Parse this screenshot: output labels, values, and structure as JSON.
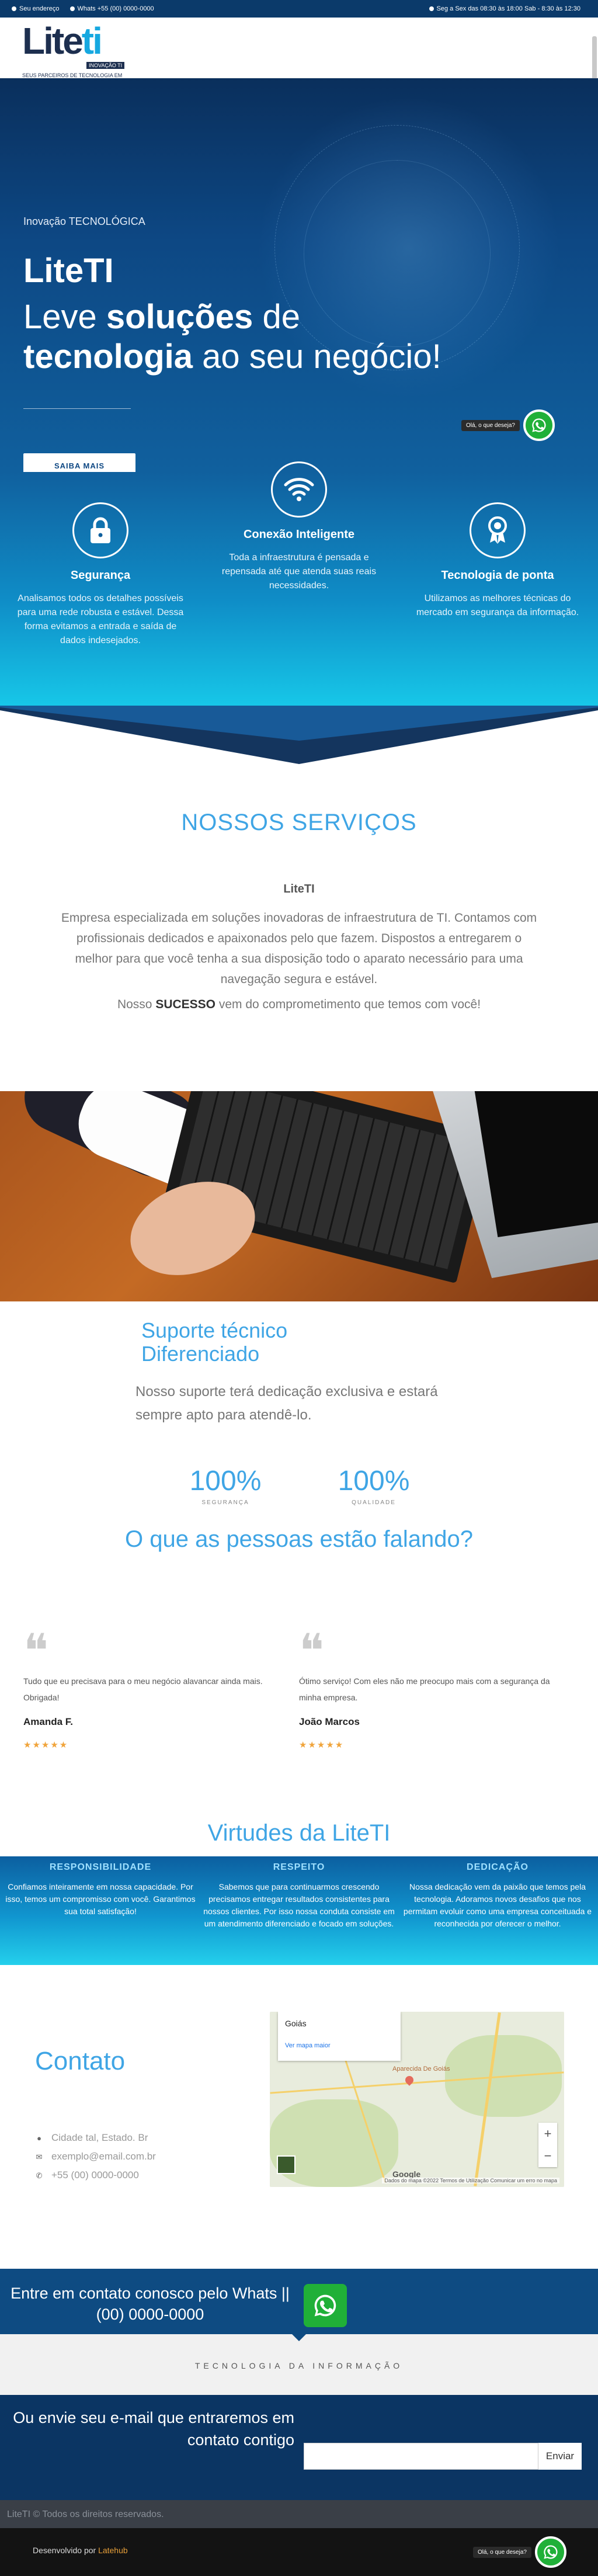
{
  "topbar": {
    "email": "Seu endereço",
    "whats": "Whats +55 (00) 0000-0000",
    "hours": "Seg a Sex das 08:30 às 18:00 Sab - 8:30 às 12:30"
  },
  "logo": {
    "brand_a": "Lite",
    "brand_b": "ti",
    "badge": "INOVAÇÃO TI",
    "tagline": "SEUS PARCEIROS DE TECNOLOGIA EM SEU NEGÓCIO"
  },
  "hero": {
    "kicker": "Inovação TECNOLÓGICA",
    "brand": "LiteTI",
    "line1_a": "Leve ",
    "line1_b": "soluções",
    "line1_c": " de",
    "line2_a": "tecnologia",
    "line2_b": " ao seu negócio!",
    "button": "SAIBA MAIS"
  },
  "whatsapp_chip": "Olá, o que deseja?",
  "features": [
    {
      "icon": "lock-icon",
      "title": "Segurança",
      "text": "Analisamos todos os detalhes possíveis para uma rede robusta e estável. Dessa forma evitamos a entrada e saída de dados indesejados."
    },
    {
      "icon": "wifi-icon",
      "title": "Conexão Inteligente",
      "text": "Toda a infraestrutura é pensada e repensada até que atenda suas reais necessidades."
    },
    {
      "icon": "award-icon",
      "title": "Tecnologia de ponta",
      "text": "Utilizamos as melhores técnicas do mercado em segurança da informação."
    }
  ],
  "services": {
    "title": "NOSSOS SERVIÇOS",
    "subtitle": "LiteTI",
    "paragraph": "Empresa especializada em soluções inovadoras de infraestrutura de TI. Contamos com profissionais dedicados e apaixonados pelo que fazem. Dispostos a entregarem o melhor para que você tenha  a sua disposição todo o aparato necessário para uma navegação segura e estável.",
    "last_a": "Nosso ",
    "last_b": "SUCESSO",
    "last_c": " vem do comprometimento que temos com você!"
  },
  "support": {
    "title_1": "Suporte técnico",
    "title_2": "Diferenciado",
    "text": "Nosso suporte terá dedicação exclusiva e estará sempre apto para atendê-lo.",
    "stats": [
      {
        "value": "100%",
        "label": "SEGURANÇA"
      },
      {
        "value": "100%",
        "label": "QUALIDADE"
      }
    ],
    "people_title": "O que as pessoas estão falando?"
  },
  "testimonials": [
    {
      "text": "Tudo que eu precisava para o meu negócio alavancar ainda mais. Obrigada!",
      "name": "Amanda F.",
      "rating": 5,
      "stars": "★★★★★"
    },
    {
      "text": "Ótimo serviço! Com eles não me preocupo mais com a segurança da minha empresa.",
      "name": "João Marcos",
      "rating": 5,
      "stars": "★★★★★"
    }
  ],
  "virtues": {
    "title": "Virtudes da LiteTI",
    "items": [
      {
        "title": "RESPONSIBILIDADE",
        "text": "Confiamos inteiramente em nossa capacidade. Por isso, temos um compromisso com você. Garantimos sua total satisfação!"
      },
      {
        "title": "RESPEITO",
        "text": "Sabemos que para continuarmos crescendo precisamos entregar resultados consistentes para nossos clientes. Por isso nossa conduta consiste em um atendimento diferenciado e focado em soluções."
      },
      {
        "title": "DEDICAÇÃO",
        "text": "Nossa dedicação vem da paixão que temos pela tecnologia. Adoramos novos desafios que nos permitam evoluir como uma empresa conceituada e reconhecida por oferecer o melhor."
      }
    ]
  },
  "contact": {
    "title": "Contato",
    "address": "Cidade tal, Estado. Br",
    "email": "exemplo@email.com.br",
    "phone": "+55 (00) 0000-0000",
    "map": {
      "place": "Goiás",
      "link": "Ver mapa maior",
      "city": "Aparecida De Goiás",
      "google": "Google",
      "credits": "Dados do mapa ©2022   Termos de Utilização   Comunicar um erro no mapa",
      "zoom_in": "+",
      "zoom_out": "−"
    }
  },
  "cta": {
    "text": "Entre em contato conosco pelo Whats || (00) 0000-0000"
  },
  "tagline": "TECNOLOGIA DA INFORMAÇÃO",
  "newsletter": {
    "text": "Ou envie seu e-mail que entraremos em contato contigo",
    "placeholder": "",
    "button": "Enviar"
  },
  "footer": {
    "copyright": "LiteTI © Todos os direitos reservados.",
    "dev_a": "Desenvolvido por ",
    "dev_b": "Latehub"
  },
  "colors": {
    "accent": "#3fa5e5",
    "dark_blue": "#0b3a6a",
    "whatsapp": "#20b038",
    "stars": "#f0a43b"
  }
}
